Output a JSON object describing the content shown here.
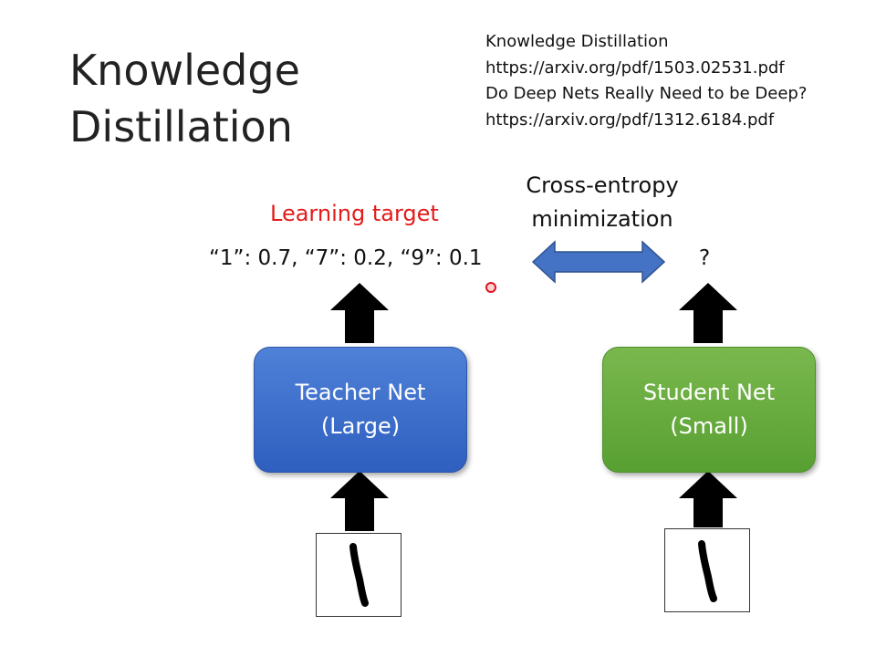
{
  "slide": {
    "title_lines": [
      "Knowledge",
      "Distillation"
    ],
    "references": [
      "Knowledge Distillation",
      "https://arxiv.org/pdf/1503.02531.pdf",
      "Do Deep Nets Really Need to be Deep?",
      "https://arxiv.org/pdf/1312.6184.pdf"
    ],
    "learning_target_label": "Learning target",
    "cross_entropy_lines": [
      "Cross-entropy",
      "minimization"
    ],
    "teacher_output": "“1”: 0.7, “7”: 0.2, “9”: 0.1",
    "student_output": "?",
    "teacher_net": {
      "line1": "Teacher Net",
      "line2": "(Large)"
    },
    "student_net": {
      "line1": "Student Net",
      "line2": "(Small)"
    }
  },
  "colors": {
    "learning_target": "#e31b1b",
    "teacher_box": "#3a6bcb",
    "student_box": "#63aa3d",
    "double_arrow": "#4472c4",
    "arrows": "#000000"
  },
  "icons": {
    "up_arrow": "block-up-arrow",
    "double_arrow": "left-right-block-arrow",
    "digit_image": "handwritten-digit-one"
  }
}
